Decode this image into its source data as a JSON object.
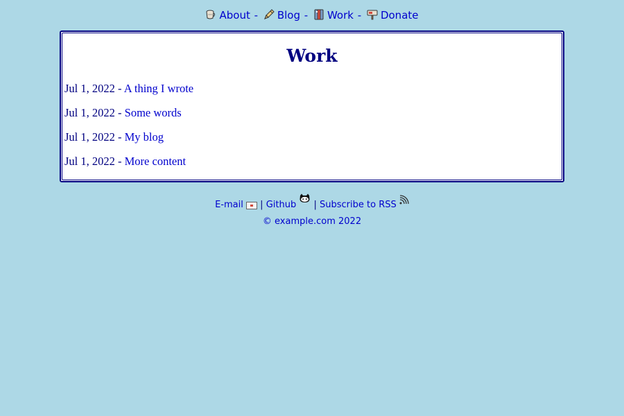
{
  "nav": {
    "items": [
      {
        "label": "About",
        "icon": "mug-icon"
      },
      {
        "label": "Blog",
        "icon": "pen-icon"
      },
      {
        "label": "Work",
        "icon": "briefcase-icon"
      },
      {
        "label": "Donate",
        "icon": "mailbox-icon"
      }
    ],
    "separator": "-"
  },
  "main": {
    "title": "Work",
    "entries": [
      {
        "date": "Jul 1, 2022",
        "sep": " - ",
        "title": "A thing I wrote"
      },
      {
        "date": "Jul 1, 2022",
        "sep": " - ",
        "title": "Some words"
      },
      {
        "date": "Jul 1, 2022",
        "sep": " - ",
        "title": "My blog"
      },
      {
        "date": "Jul 1, 2022",
        "sep": " - ",
        "title": "More content"
      }
    ]
  },
  "footer": {
    "email": "E-mail",
    "github": "Github",
    "rss": "Subscribe to RSS",
    "divider": "|",
    "copyright": "© example.com 2022"
  },
  "colors": {
    "background": "#add8e6",
    "link": "#0000cd",
    "text": "#000080",
    "card": "#ffffff"
  }
}
